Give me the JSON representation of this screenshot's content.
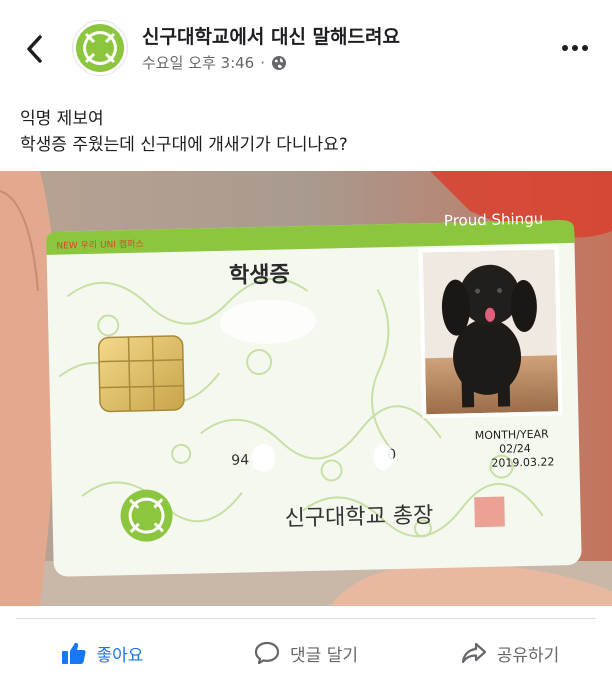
{
  "header": {
    "page_name": "신구대학교에서 대신 말해드려요",
    "time": "수요일 오후 3:46",
    "separator": "·",
    "back_icon": "chevron-left-icon",
    "more_icon": "more-horizontal-icon",
    "privacy_icon": "globe-icon"
  },
  "avatar": {
    "logo_text": "新丘"
  },
  "post": {
    "line1": "익명 제보여",
    "line2": "학생증 주웠는데 신구대에 개새기가 다니나요?"
  },
  "card": {
    "brand": "Proud Shingu",
    "tagline": "NEW 우리 UNI 캠퍼스",
    "title": "학생증",
    "number_left": "94",
    "number_right": "0",
    "validity_label": "MONTH/YEAR",
    "validity_value": "02/24",
    "issue_date": "2019.03.22",
    "signature": "신구대학교 총장"
  },
  "actions": {
    "like": "좋아요",
    "comment": "댓글 달기",
    "share": "공유하기"
  },
  "colors": {
    "brand_green": "#8cc63f",
    "like_blue": "#1877f2",
    "secondary_text": "#65676b"
  }
}
